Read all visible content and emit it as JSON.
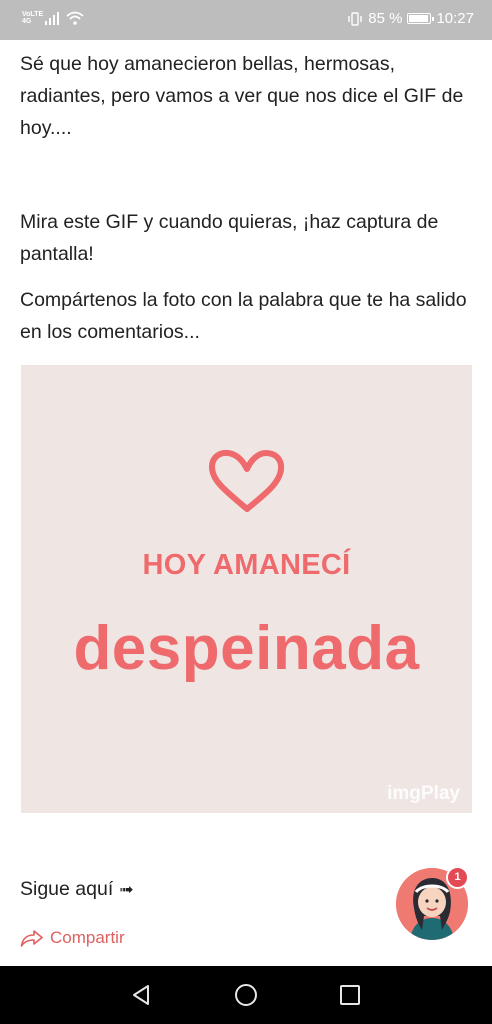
{
  "status_bar": {
    "carrier": "VoLTE 4G",
    "battery_percent": "85 %",
    "battery_level": 0.85,
    "time": "10:27"
  },
  "article": {
    "paragraph1": "Sé que hoy amanecieron bellas, hermosas, radiantes, pero vamos a ver que nos dice el GIF de hoy....",
    "paragraph2": "Mira este GIF y cuando quieras, ¡haz captura de pantalla!",
    "paragraph3": "Compártenos la foto con la palabra que te ha salido en los comentarios..."
  },
  "gif": {
    "line1": "HOY AMANECÍ",
    "line2": "despeinada",
    "watermark": "imgPlay",
    "background": "#efe6e4",
    "accent": "#ee6a6c"
  },
  "follow": {
    "label": "Sigue aquí",
    "arrow": "➟"
  },
  "share": {
    "label": "Compartir"
  },
  "chat": {
    "badge_count": "1"
  },
  "colors": {
    "accent": "#e0605f",
    "navbar": "#000000",
    "statusbar": "#bdbdbd"
  }
}
